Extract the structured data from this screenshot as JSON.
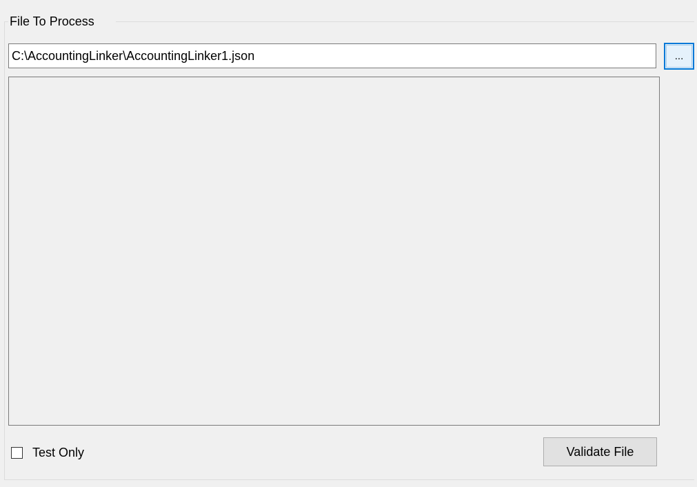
{
  "file_group": {
    "title": "File To Process",
    "file_path": {
      "value": "C:\\AccountingLinker\\AccountingLinker1.json",
      "placeholder": ""
    },
    "browse_button_label": "..."
  },
  "output_panel": {
    "content": ""
  },
  "options": {
    "test_only_label": "Test Only",
    "test_only_checked": false
  },
  "actions": {
    "validate_label": "Validate File"
  },
  "colors": {
    "window_background": "#f0f0f0",
    "focus_accent": "#0078d7",
    "button_face": "#e1e1e1"
  }
}
